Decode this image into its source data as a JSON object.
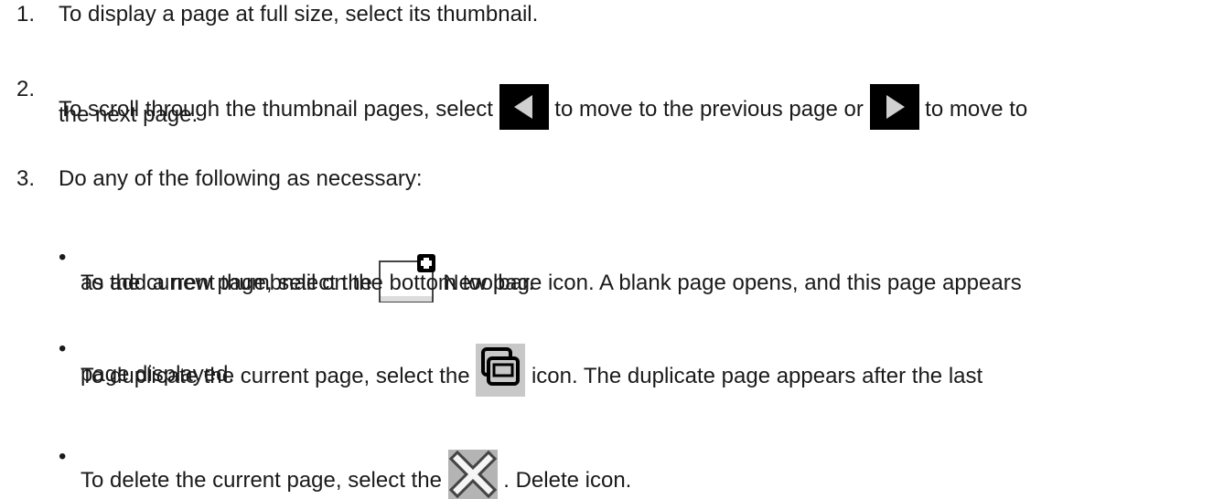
{
  "steps": [
    {
      "num": "1.",
      "text": "To display a page at full size, select its thumbnail."
    },
    {
      "num": "2.",
      "text_a": "To scroll through the thumbnail pages, select",
      "text_b": "to move to the previous page or",
      "text_c": "to move to",
      "text_d": "the next page."
    },
    {
      "num": "3.",
      "text": "Do any of the following as necessary:"
    }
  ],
  "bullets": [
    {
      "before": "To add a new page, select the",
      "after": "New page icon. A blank page opens, and this page appears",
      "line2": "as the current thumbnail on the bottom toolbar."
    },
    {
      "before": "To duplicate the current page, select the",
      "after": "icon. The duplicate page appears after the last",
      "line2": "page displayed."
    },
    {
      "before": "To delete the current page, select the",
      "after": ". Delete icon."
    }
  ],
  "icons": {
    "previous": "previous-page-icon",
    "next": "next-page-icon",
    "new_page": "new-page-icon",
    "duplicate": "duplicate-page-icon",
    "delete": "delete-icon"
  }
}
